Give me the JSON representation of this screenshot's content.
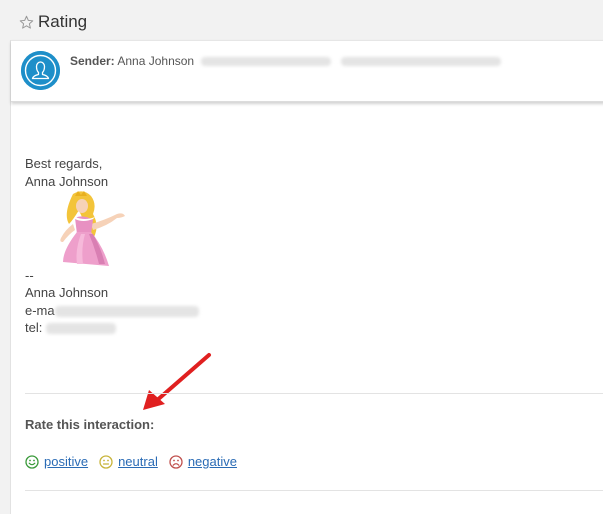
{
  "header": {
    "title": "Rating",
    "icon": "star-outline-icon"
  },
  "sender": {
    "label": "Sender:",
    "name": "Anna Johnson",
    "avatar_icon": "user-avatar-icon",
    "avatar_color": "#1e8fc9"
  },
  "message": {
    "closing": "Best regards,",
    "closing_name": "Anna Johnson",
    "signature_separator": "--",
    "signature_name": "Anna Johnson",
    "email_prefix": "e-ma",
    "tel_prefix": "tel: "
  },
  "rating": {
    "heading": "Rate this interaction:",
    "options": [
      {
        "label": "positive",
        "icon": "smiley-happy-icon",
        "color": "#3a9a3a"
      },
      {
        "label": "neutral",
        "icon": "smiley-neutral-icon",
        "color": "#c8b43a"
      },
      {
        "label": "negative",
        "icon": "smiley-sad-icon",
        "color": "#c0504d"
      }
    ]
  },
  "annotation": {
    "arrow_color": "#e02020"
  }
}
